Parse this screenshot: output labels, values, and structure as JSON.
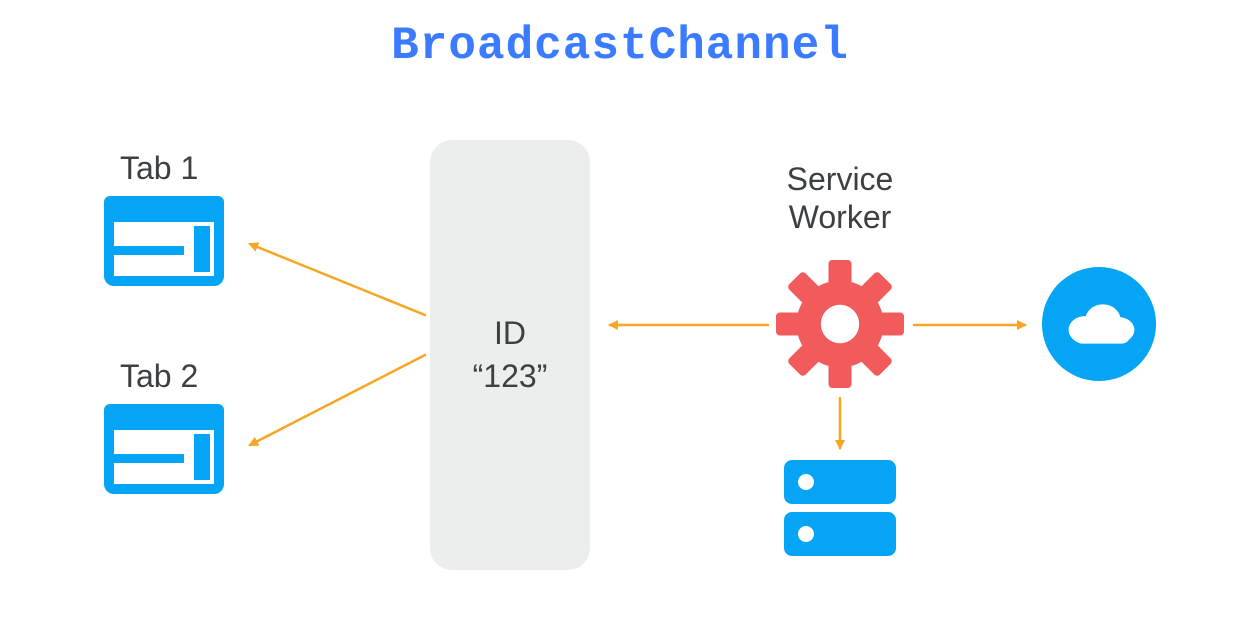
{
  "title": "BroadcastChannel",
  "tabs": [
    {
      "label": "Tab 1"
    },
    {
      "label": "Tab 2"
    }
  ],
  "channel": {
    "line1": "ID",
    "line2": "“123”"
  },
  "service_worker": {
    "line1": "Service",
    "line2": "Worker"
  },
  "colors": {
    "accent_blue": "#06a4f4",
    "title_blue": "#3a7bff",
    "gear_red": "#f15b5b",
    "arrow_orange": "#f6a623",
    "panel_gray": "#eceded",
    "text": "#3c4043"
  },
  "icons": {
    "tab": "browser-window-icon",
    "gear": "gear-icon",
    "cloud": "cloud-icon",
    "storage": "server-storage-icon"
  }
}
